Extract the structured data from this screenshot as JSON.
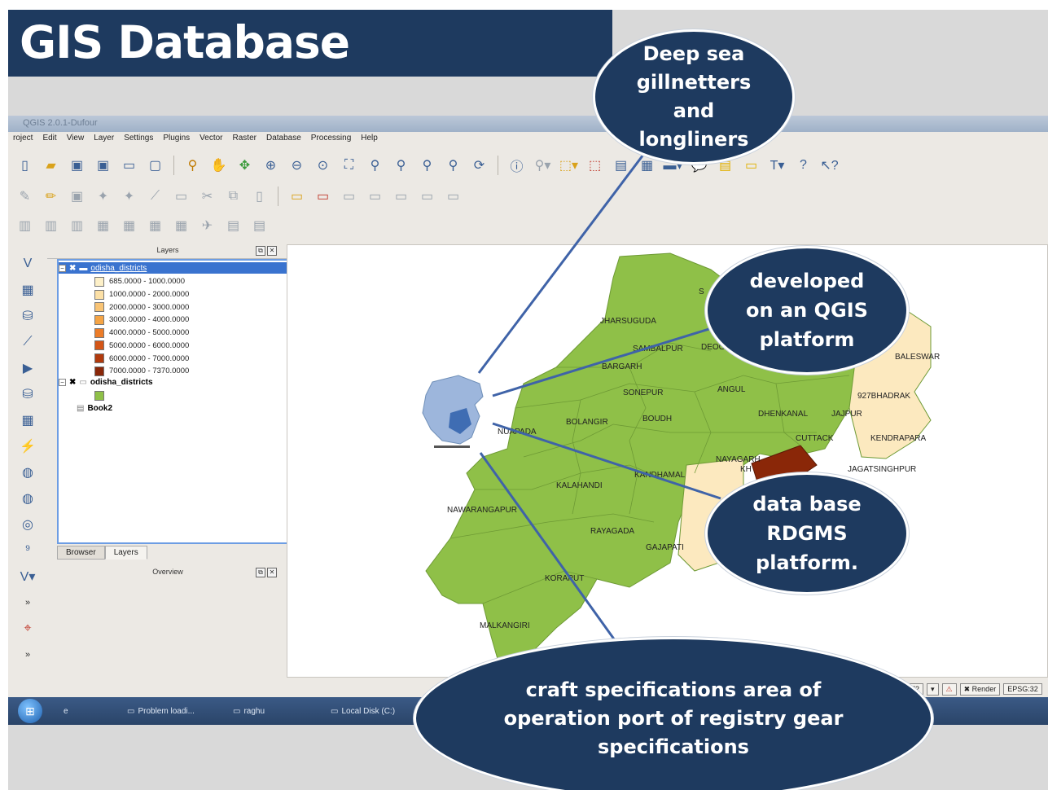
{
  "slide": {
    "title": "GIS Database",
    "colors": {
      "title_bg": "#1e3a5f",
      "callout_bg": "#1e3a5f",
      "map_green": "#8fc048"
    }
  },
  "callouts": {
    "deep_sea": [
      "Deep sea",
      "gillnetters",
      "and",
      "longliners"
    ],
    "qgis": [
      "developed",
      "on an QGIS",
      "platform"
    ],
    "rdgms": [
      "data base",
      "RDGMS",
      "platform."
    ],
    "craft": [
      "craft specifications area of",
      "operation port of registry gear",
      "specifications"
    ]
  },
  "app": {
    "window_title": "QGIS 2.0.1-Dufour",
    "menu": [
      "roject",
      "Edit",
      "View",
      "Layer",
      "Settings",
      "Plugins",
      "Vector",
      "Raster",
      "Database",
      "Processing",
      "Help"
    ],
    "layers_panel": {
      "title": "Layers",
      "selected_layer": "odisha_districts",
      "legend": [
        {
          "label": "685.0000 - 1000.0000",
          "color": "#fdf0c8"
        },
        {
          "label": "1000.0000 - 2000.0000",
          "color": "#fce0a6"
        },
        {
          "label": "2000.0000 - 3000.0000",
          "color": "#f9c475"
        },
        {
          "label": "3000.0000 - 4000.0000",
          "color": "#f5a445"
        },
        {
          "label": "4000.0000 - 5000.0000",
          "color": "#ec7c28"
        },
        {
          "label": "5000.0000 - 6000.0000",
          "color": "#d45516"
        },
        {
          "label": "6000.0000 - 7000.0000",
          "color": "#b13a0c"
        },
        {
          "label": "7000.0000 - 7370.0000",
          "color": "#8a2708"
        }
      ],
      "second_layer": "odisha_districts",
      "second_layer_color": "#8fc048",
      "third_item": "Book2"
    },
    "tabs": {
      "browser": "Browser",
      "layers": "Layers"
    },
    "overview_title": "Overview",
    "status": {
      "scale": "72",
      "render": "Render",
      "crs": "EPSG:32"
    },
    "taskbar": [
      "Problem loadi...",
      "raghu",
      "Local Disk (C:)"
    ]
  },
  "map": {
    "districts": [
      "JHARSUGUDA",
      "SAMBALPUR",
      "DEOGARH",
      "BARGARH",
      "BALESWAR",
      "SONEPUR",
      "ANGUL",
      "927BHADRAK",
      "BOLANGIR",
      "BOUDH",
      "DHENKANAL",
      "JAJPUR",
      "NUAPADA",
      "CUTTACK",
      "KENDRAPARA",
      "NAYAGARH",
      "KH",
      "KANDHAMAL",
      "JAGATSINGHPUR",
      "KALAHANDI",
      "NAWARANGAPUR",
      "RAYAGADA",
      "GAJAPATI",
      "KORAPUT",
      "MALKANGIRI",
      "S"
    ]
  }
}
